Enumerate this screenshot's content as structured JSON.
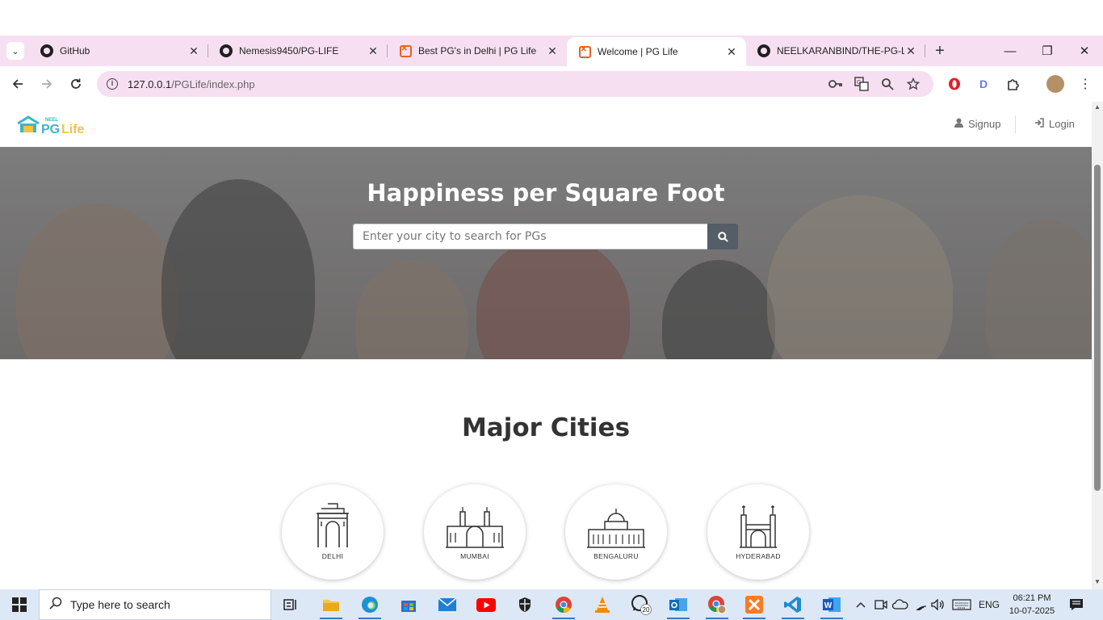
{
  "browser": {
    "tabs": [
      {
        "title": "GitHub",
        "icon": "github-icon"
      },
      {
        "title": "Nemesis9450/PG-LIFE",
        "icon": "github-icon"
      },
      {
        "title": "Best PG's in Delhi | PG Life",
        "icon": "xampp-icon"
      },
      {
        "title": "Welcome | PG Life",
        "icon": "xampp-icon",
        "active": true
      },
      {
        "title": "NEELKARANBIND/THE-PG-L",
        "icon": "github-icon"
      }
    ],
    "url_host": "127.0.0.1",
    "url_path": "/PGLife/index.php"
  },
  "site": {
    "logo_top": "NEEL",
    "logo_main": "PG Life",
    "signup_label": "Signup",
    "login_label": "Login",
    "banner_title": "Happiness per Square Foot",
    "search_placeholder": "Enter your city to search for PGs",
    "section_title": "Major Cities",
    "cities": [
      {
        "name": "DELHI"
      },
      {
        "name": "MUMBAI"
      },
      {
        "name": "BENGALURU"
      },
      {
        "name": "HYDERABAD"
      }
    ]
  },
  "taskbar": {
    "search_placeholder": "Type here to search",
    "whatsapp_badge": "20",
    "language": "ENG",
    "time": "06:21 PM",
    "date": "10-07-2025"
  },
  "colors": {
    "tab_bar": "#f7dff2",
    "banner_overlay": "#7a7878",
    "search_button": "#555d66",
    "taskbar": "#dce8f5"
  }
}
